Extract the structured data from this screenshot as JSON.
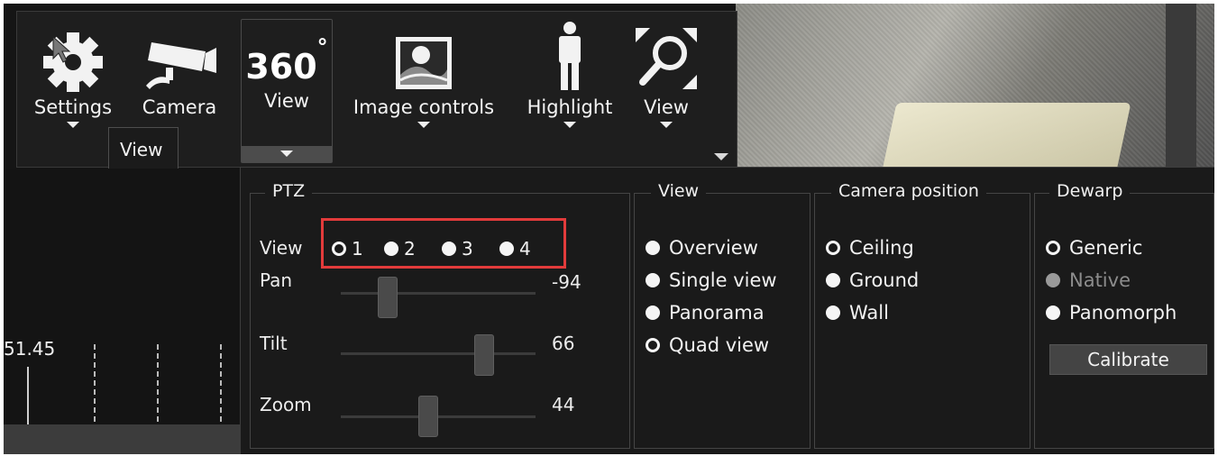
{
  "toolbar": {
    "settings_label": "Settings",
    "camera_label": "Camera",
    "view360_glyph": "360",
    "view360_degree": "°",
    "view360_label": "View",
    "image_controls_label": "Image controls",
    "highlight_label": "Highlight",
    "zoom_view_label": "View",
    "tooltip": "View",
    "icons": [
      "gear-icon",
      "security-camera-icon",
      "360-view-icon",
      "image-icon",
      "person-icon",
      "zoom-fit-icon",
      "chevron-down-icon"
    ]
  },
  "left_panel": {
    "value": "51.45"
  },
  "ptz": {
    "title": "PTZ",
    "view_label": "View",
    "view_options": [
      {
        "label": "1",
        "selected": true
      },
      {
        "label": "2",
        "selected": false
      },
      {
        "label": "3",
        "selected": false
      },
      {
        "label": "4",
        "selected": false
      }
    ],
    "pan": {
      "label": "Pan",
      "value": "-94"
    },
    "tilt": {
      "label": "Tilt",
      "value": "66"
    },
    "zoom": {
      "label": "Zoom",
      "value": "44"
    }
  },
  "view": {
    "title": "View",
    "options": [
      {
        "label": "Overview",
        "selected": false
      },
      {
        "label": "Single view",
        "selected": false
      },
      {
        "label": "Panorama",
        "selected": false
      },
      {
        "label": "Quad view",
        "selected": true
      }
    ]
  },
  "camera_position": {
    "title": "Camera position",
    "options": [
      {
        "label": "Ceiling",
        "selected": true
      },
      {
        "label": "Ground",
        "selected": false
      },
      {
        "label": "Wall",
        "selected": false
      }
    ]
  },
  "dewarp": {
    "title": "Dewarp",
    "options": [
      {
        "label": "Generic",
        "selected": true,
        "disabled": false
      },
      {
        "label": "Native",
        "selected": false,
        "disabled": true
      },
      {
        "label": "Panomorph",
        "selected": false,
        "disabled": false
      }
    ],
    "calibrate_label": "Calibrate"
  },
  "colors": {
    "background": "#1c1c1c",
    "panel": "#1a1a1a",
    "text": "#f2f2f2",
    "highlight_box": "#e23b3b"
  }
}
